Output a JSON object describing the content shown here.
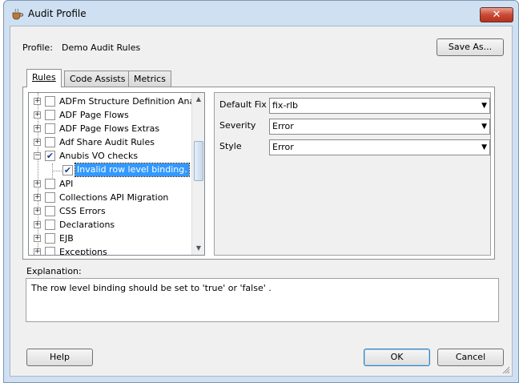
{
  "window": {
    "title": "Audit Profile",
    "close_glyph": "✕"
  },
  "profile": {
    "label": "Profile:",
    "value": "Demo Audit Rules",
    "save_as_label": "Save As..."
  },
  "tabs": [
    {
      "label": "Rules",
      "active": true
    },
    {
      "label": "Code Assists",
      "active": false
    },
    {
      "label": "Metrics",
      "active": false
    }
  ],
  "tree": {
    "items": [
      {
        "label": "ADFm Structure Definition Analyzer",
        "expander": "+",
        "checked": false
      },
      {
        "label": "ADF Page Flows",
        "expander": "+",
        "checked": false
      },
      {
        "label": "ADF Page Flows Extras",
        "expander": "+",
        "checked": false
      },
      {
        "label": "Adf Share Audit Rules",
        "expander": "+",
        "checked": false
      },
      {
        "label": "Anubis VO checks",
        "expander": "−",
        "checked": true
      },
      {
        "label": "Invalid row level binding.",
        "expander": "",
        "checked": true,
        "child": true,
        "selected": true
      },
      {
        "label": "API",
        "expander": "+",
        "checked": false
      },
      {
        "label": "Collections API Migration",
        "expander": "+",
        "checked": false
      },
      {
        "label": "CSS Errors",
        "expander": "+",
        "checked": false
      },
      {
        "label": "Declarations",
        "expander": "+",
        "checked": false
      },
      {
        "label": "EJB",
        "expander": "+",
        "checked": false
      },
      {
        "label": "Exceptions",
        "expander": "+",
        "checked": false
      }
    ],
    "check_glyph": "✔"
  },
  "properties": {
    "default_fix": {
      "label": "Default Fix",
      "value": "fix-rlb"
    },
    "severity": {
      "label": "Severity",
      "value": "Error"
    },
    "style": {
      "label": "Style",
      "value": "Error"
    }
  },
  "explanation": {
    "label": "Explanation:",
    "text": "The row level binding should be set to 'true' or 'false' ."
  },
  "footer": {
    "help_label": "Help",
    "ok_label": "OK",
    "cancel_label": "Cancel"
  }
}
